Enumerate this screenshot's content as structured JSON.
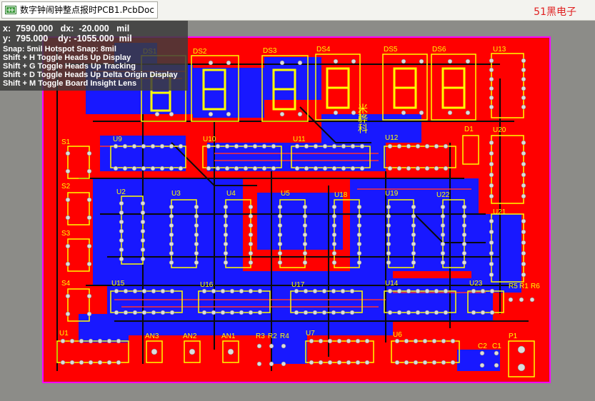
{
  "tab": {
    "title": "数字钟闹钟整点报时PCB1.PcbDoc"
  },
  "watermark": "51黑电子",
  "hud": {
    "x_label": "x:",
    "x_value": "7590.000",
    "dx_label": "dx:",
    "dx_value": "-20.000",
    "y_label": "y:",
    "y_value": "795.000",
    "dy_label": "dy:",
    "dy_value": "-1055.000",
    "unit": "mil",
    "snap": "Snap: 5mil Hotspot Snap: 8mil",
    "shortcuts": [
      "Shift + H   Toggle Heads Up Display",
      "Shift + G   Toggle Heads Up Tracking",
      "Shift + D   Toggle Heads Up Delta Origin Display",
      "Shift + M   Toggle Board Insight Lens"
    ]
  },
  "pcb": {
    "background_color": "#8c8c88",
    "board_color": "#ff0000",
    "bottom_layer_color": "#1010ff",
    "overlay_color": "#ffff00",
    "designators": [
      "DS1",
      "DS2",
      "DS3",
      "DS4",
      "DS5",
      "DS6",
      "U13",
      "D1",
      "U20",
      "S1",
      "U9",
      "U10",
      "U11",
      "U12",
      "S2",
      "U2",
      "U3",
      "U4",
      "U5",
      "U18",
      "U19",
      "U22",
      "U21",
      "S3",
      "S4",
      "U15",
      "U16",
      "U17",
      "U14",
      "U23",
      "R5",
      "R1",
      "R6",
      "U1",
      "AN3",
      "AN2",
      "AN1",
      "R3",
      "R2",
      "R4",
      "U7",
      "U6",
      "C2",
      "C1",
      "P1"
    ],
    "silk_text": "米骅科"
  }
}
